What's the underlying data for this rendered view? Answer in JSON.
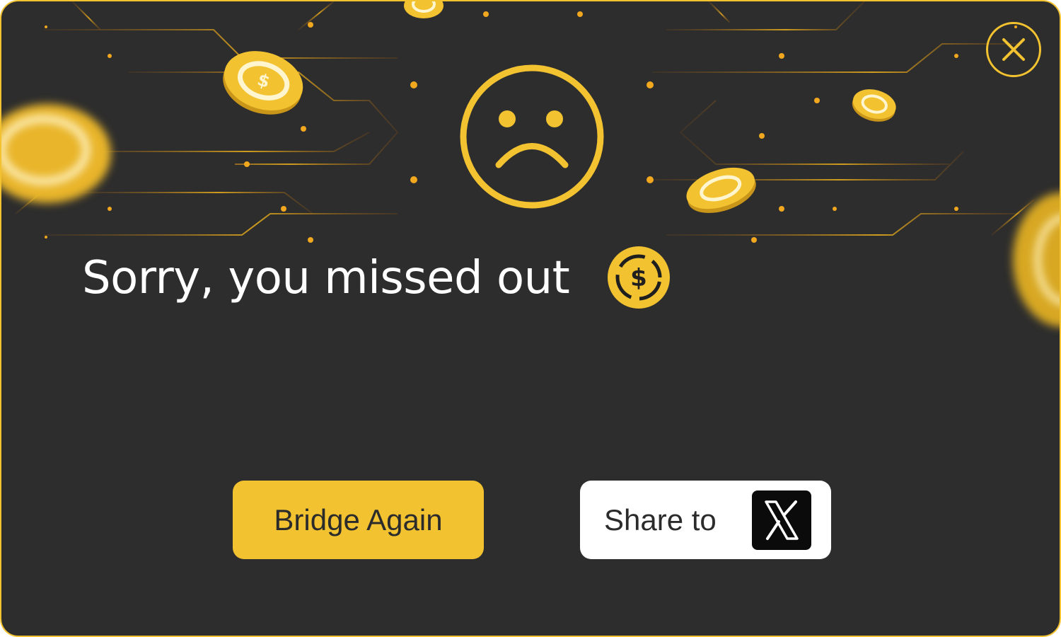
{
  "dialog": {
    "headline": "Sorry, you missed out",
    "buttons": {
      "bridge_again_label": "Bridge Again",
      "share_label": "Share to"
    }
  },
  "icons": {
    "close": "close-icon",
    "sad_face": "sad-face-icon",
    "usdc": "usdc-coin-icon",
    "x_logo": "x-logo-icon"
  },
  "colors": {
    "accent": "#f2c230",
    "background": "#2d2d2d",
    "text": "#ffffff",
    "button_text": "#2b2b2b",
    "share_button_bg": "#ffffff"
  }
}
